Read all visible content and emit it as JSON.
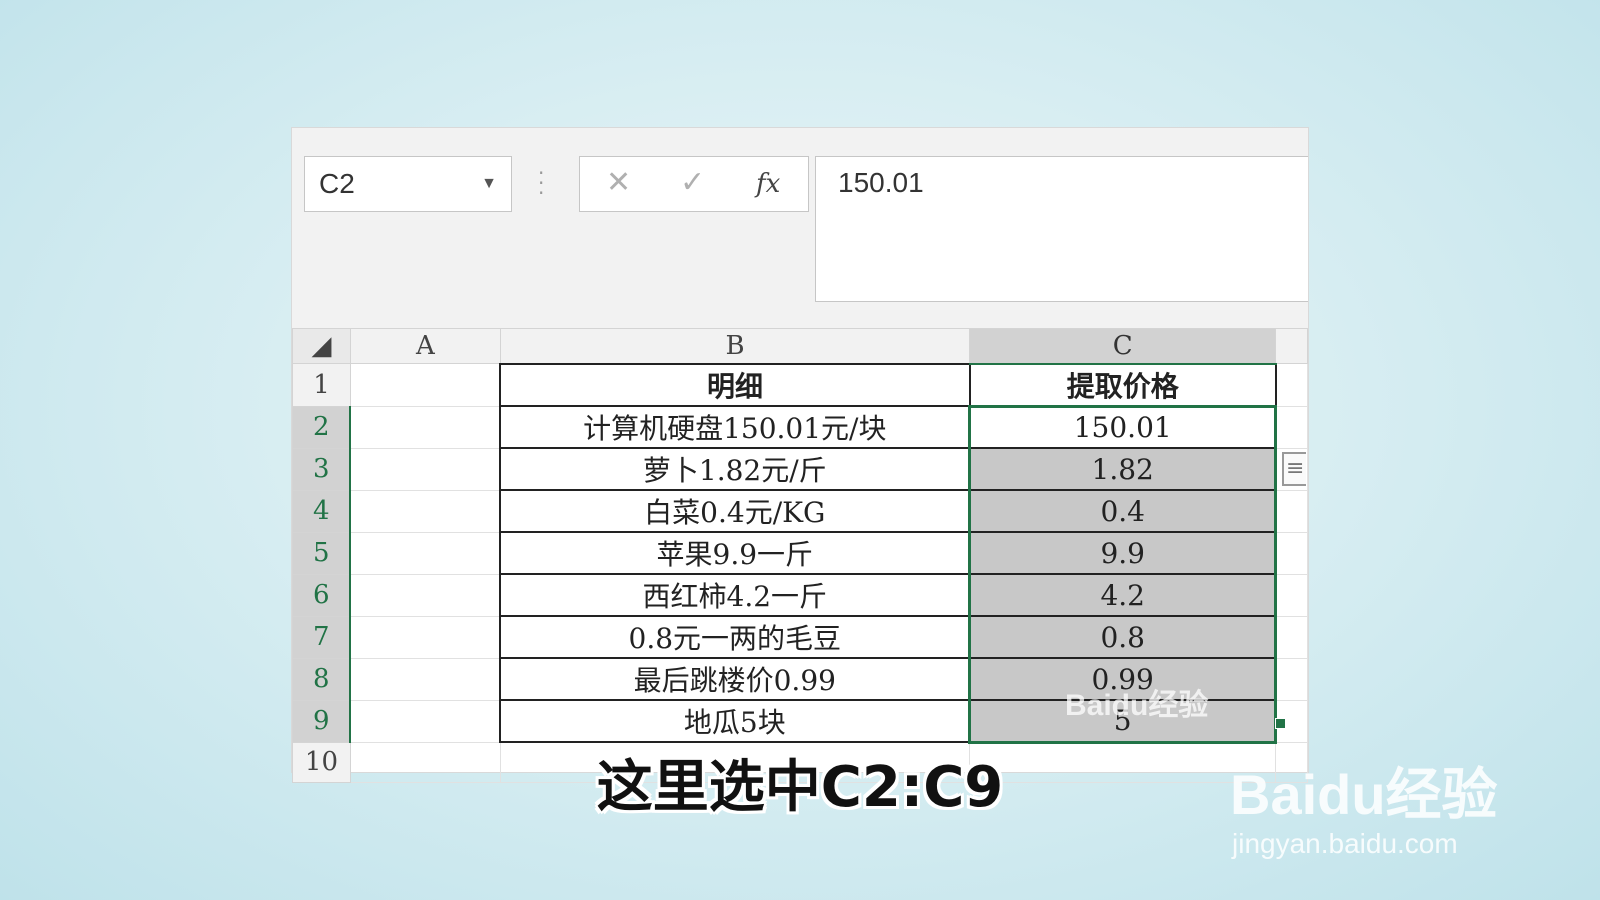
{
  "formula_bar": {
    "name_box": "C2",
    "name_box_dropdown_icon": "caret-down-icon",
    "cancel_icon": "✕",
    "enter_icon": "✓",
    "fx_label": "fx",
    "formula_value": "150.01"
  },
  "columns": [
    "A",
    "B",
    "C"
  ],
  "rows": [
    {
      "num": "1",
      "a": "",
      "b": "明细",
      "c": "提取价格"
    },
    {
      "num": "2",
      "a": "",
      "b": "计算机硬盘150.01元/块",
      "c": "150.01"
    },
    {
      "num": "3",
      "a": "",
      "b": "萝卜1.82元/斤",
      "c": "1.82"
    },
    {
      "num": "4",
      "a": "",
      "b": "白菜0.4元/KG",
      "c": "0.4"
    },
    {
      "num": "5",
      "a": "",
      "b": "苹果9.9一斤",
      "c": "9.9"
    },
    {
      "num": "6",
      "a": "",
      "b": "西红柿4.2一斤",
      "c": "4.2"
    },
    {
      "num": "7",
      "a": "",
      "b": "0.8元一两的毛豆",
      "c": "0.8"
    },
    {
      "num": "8",
      "a": "",
      "b": "最后跳楼价0.99",
      "c": "0.99"
    },
    {
      "num": "9",
      "a": "",
      "b": "地瓜5块",
      "c": "5"
    },
    {
      "num": "10",
      "a": "",
      "b": "",
      "c": ""
    }
  ],
  "subtitle": "这里选中C2:C9",
  "watermark": {
    "cell_mark": "Baidu经验",
    "brand": "Baidu经验",
    "url": "jingyan.baidu.com"
  },
  "colors": {
    "selection": "#217346",
    "selected_fill": "#c8c8c8"
  }
}
